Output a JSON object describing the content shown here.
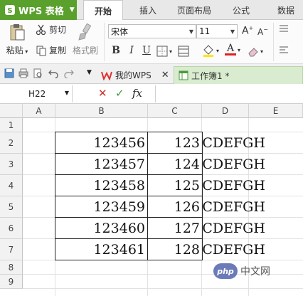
{
  "app": {
    "name": "WPS 表格"
  },
  "menu": {
    "tabs": [
      "开始",
      "插入",
      "页面布局",
      "公式",
      "数据"
    ]
  },
  "ribbon": {
    "paste_label": "粘贴",
    "cut_label": "剪切",
    "copy_label": "复制",
    "format_painter_label": "格式刷",
    "font_name": "宋体",
    "font_size": "11",
    "bold": "B",
    "italic": "I",
    "underline": "U"
  },
  "doc_tabs": [
    {
      "label": "我的WPS"
    },
    {
      "label": "工作簿1 *"
    }
  ],
  "formula_bar": {
    "name_box": "H22",
    "fx": "fx",
    "formula": ""
  },
  "sheet": {
    "columns": [
      "A",
      "B",
      "C",
      "D",
      "E"
    ],
    "rows": [
      "1",
      "2",
      "3",
      "4",
      "5",
      "6",
      "7",
      "8",
      "9"
    ],
    "data_rows": [
      {
        "b": "123456",
        "c": "123",
        "d": "BCDEFGH"
      },
      {
        "b": "123457",
        "c": "124",
        "d": "BCDEFGH"
      },
      {
        "b": "123458",
        "c": "125",
        "d": "BCDEFGH"
      },
      {
        "b": "123459",
        "c": "126",
        "d": "BCDEFGH"
      },
      {
        "b": "123460",
        "c": "127",
        "d": "BCDEFGH"
      },
      {
        "b": "123461",
        "c": "128",
        "d": "BCDEFGH"
      }
    ]
  },
  "watermark": {
    "logo": "php",
    "text": "中文网"
  },
  "colors": {
    "brand_green": "#5aa02c",
    "font_color_red": "#e02020"
  }
}
